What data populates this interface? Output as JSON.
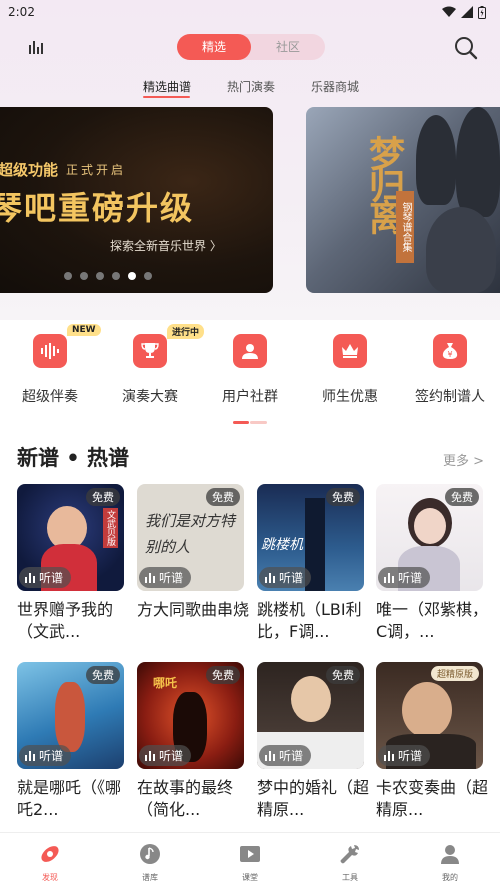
{
  "status": {
    "time": "2:02"
  },
  "header": {
    "segments": [
      "精选",
      "社区"
    ]
  },
  "subtabs": [
    "精选曲谱",
    "热门演奏",
    "乐器商城"
  ],
  "banners": [
    {
      "tag": "超级功能",
      "tag2": "正式开启",
      "headline": "琴吧重磅升级",
      "subtitle": "探索全新音乐世界 〉"
    },
    {
      "title": "梦归离",
      "stamp": "钢琴谱合集"
    }
  ],
  "features": [
    {
      "label": "超级伴奏",
      "badge": "NEW",
      "icon": "waveform-icon"
    },
    {
      "label": "演奏大赛",
      "badge": "进行中",
      "icon": "trophy-icon"
    },
    {
      "label": "用户社群",
      "badge": "",
      "icon": "user-group-icon"
    },
    {
      "label": "师生优惠",
      "badge": "",
      "icon": "crown-icon"
    },
    {
      "label": "签约制谱人",
      "badge": "",
      "icon": "money-bag-icon"
    }
  ],
  "section": {
    "title": "新谱 • 热谱",
    "more": "更多 >"
  },
  "cards": [
    {
      "title": "世界赠予我的（文武...",
      "free": "免费",
      "listen": "听谱",
      "cover_text": "文武贝版"
    },
    {
      "title": "方大同歌曲串烧",
      "free": "免费",
      "listen": "听谱",
      "cover_text": "我们是对方特别的人"
    },
    {
      "title": "跳楼机（LBI利比，F调...",
      "free": "免费",
      "listen": "听谱",
      "cover_text": "跳楼机"
    },
    {
      "title": "唯一（邓紫棋，C调，...",
      "free": "免费",
      "listen": "听谱",
      "cover_text": ""
    },
    {
      "title": "就是哪吒（《哪吒2...",
      "free": "免费",
      "listen": "听谱",
      "cover_text": ""
    },
    {
      "title": "在故事的最终（简化...",
      "free": "免费",
      "listen": "听谱",
      "cover_text": "哪吒"
    },
    {
      "title": "梦中的婚礼（超精原...",
      "free": "免费",
      "listen": "听谱",
      "cover_text": ""
    },
    {
      "title": "卡农变奏曲（超精原...",
      "free": "",
      "listen": "听谱",
      "cover_text": "超精原版"
    }
  ],
  "tabbar": [
    {
      "label": "发现",
      "icon": "discover-icon"
    },
    {
      "label": "谱库",
      "icon": "music-library-icon"
    },
    {
      "label": "课堂",
      "icon": "play-video-icon"
    },
    {
      "label": "工具",
      "icon": "wrench-icon"
    },
    {
      "label": "我的",
      "icon": "profile-icon"
    }
  ],
  "colors": {
    "accent": "#f45a55"
  }
}
